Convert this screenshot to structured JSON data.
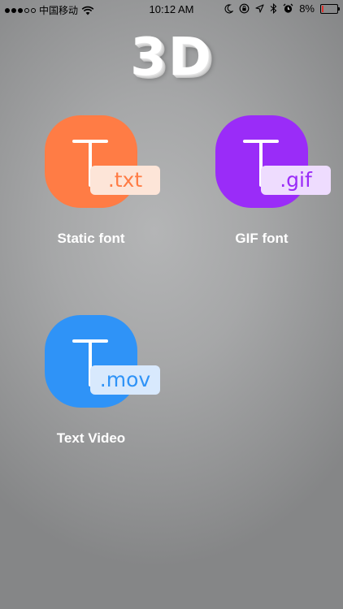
{
  "status_bar": {
    "carrier": "中国移动",
    "time": "10:12 AM",
    "battery": "8%",
    "battery_level": 0.08,
    "icons": [
      "wifi-icon",
      "moon-icon",
      "orientation-lock-icon",
      "location-icon",
      "bluetooth-icon",
      "alarm-icon",
      "battery-icon"
    ]
  },
  "header": {
    "title": "3D"
  },
  "apps": [
    {
      "label": "Static font",
      "extension": ".txt",
      "icon": "text-file-icon",
      "color": "#ff7c45",
      "badge_bg": "#fde5d8",
      "badge_text_color": "#ff7c45"
    },
    {
      "label": "GIF font",
      "extension": ".gif",
      "icon": "text-gif-icon",
      "color": "#9a2cf8",
      "badge_bg": "#eedcfe",
      "badge_text_color": "#9a2cf8"
    },
    {
      "label": "Text Video",
      "extension": ".mov",
      "icon": "text-video-icon",
      "color": "#2f93f7",
      "badge_bg": "#d8e9fd",
      "badge_text_color": "#2f93f7"
    }
  ]
}
